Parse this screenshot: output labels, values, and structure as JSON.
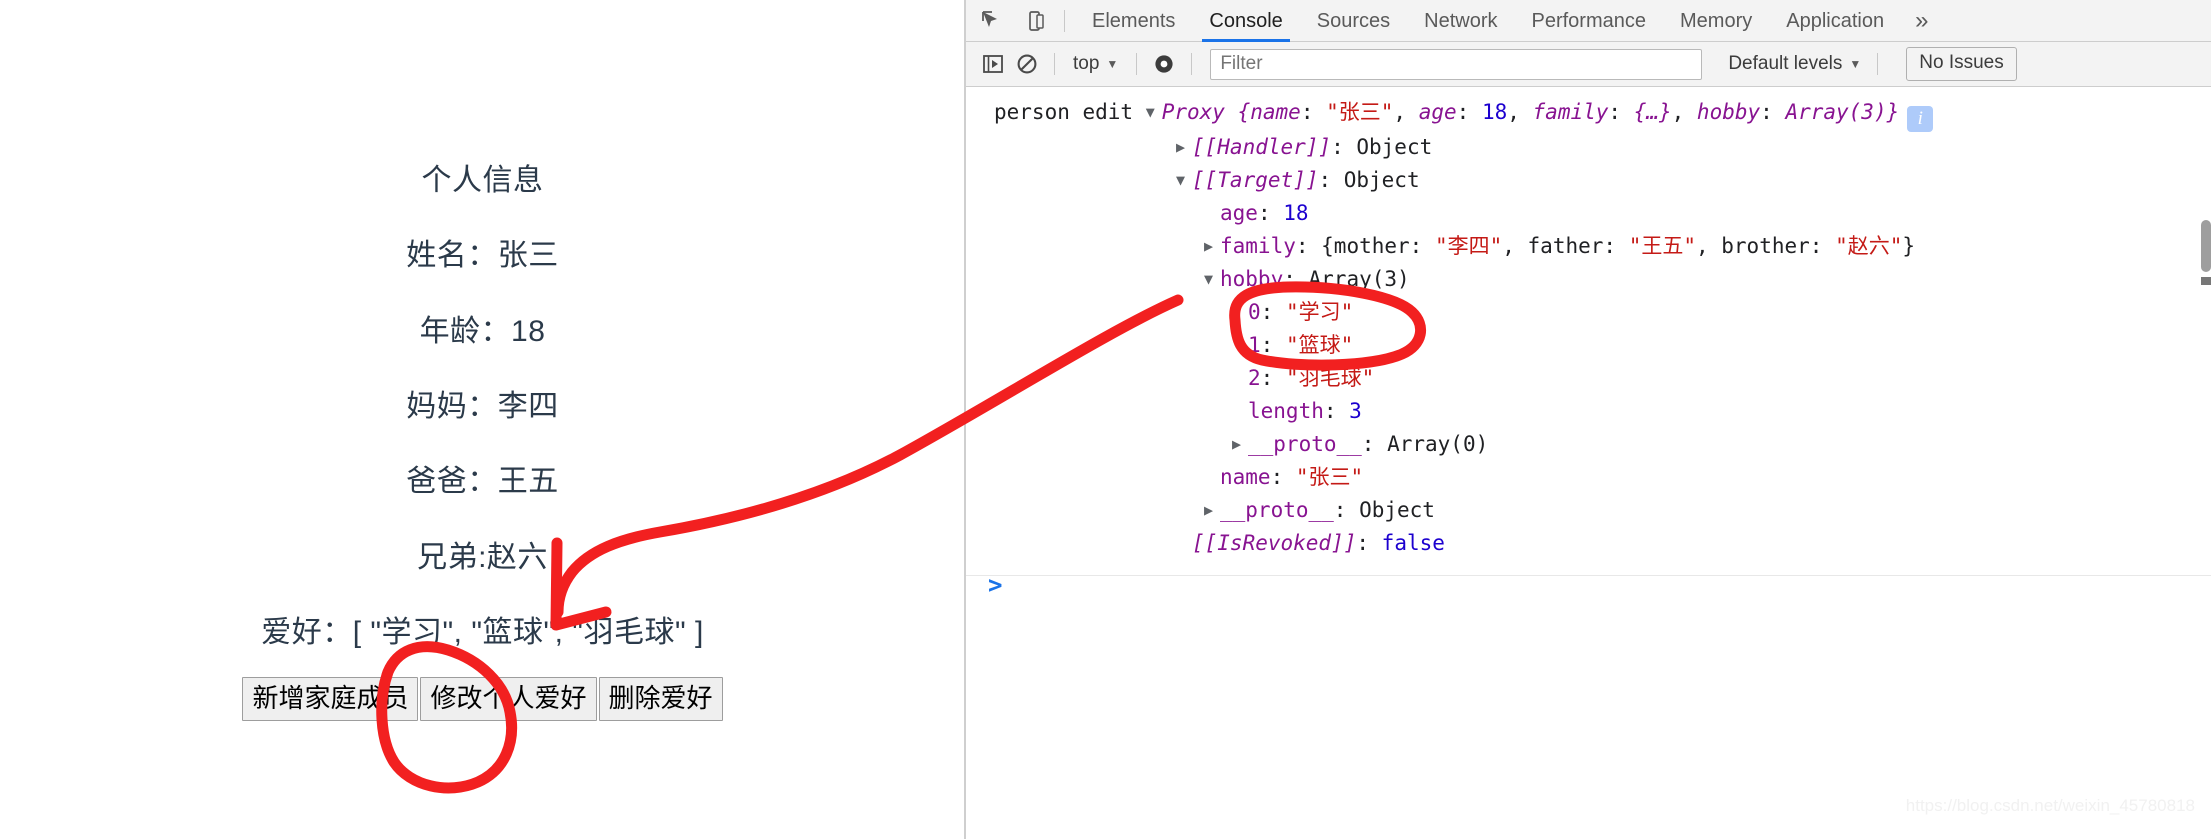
{
  "webpage": {
    "title": "个人信息",
    "rows": [
      "姓名：张三",
      "年龄：18",
      "妈妈：李四",
      "爸爸：王五",
      "兄弟:赵六",
      "爱好：[ \"学习\", \"篮球\", \"羽毛球\" ]"
    ],
    "buttons": [
      "新增家庭成员",
      "修改个人爱好",
      "删除爱好"
    ],
    "text_color": "#2b3a4a"
  },
  "devtools": {
    "icons": {
      "inspect": "inspect-element-icon",
      "device": "device-toolbar-icon",
      "execute": "execute-snippet-icon",
      "clear": "clear-console-icon",
      "eye": "live-expression-icon"
    },
    "tabs": [
      {
        "label": "Elements",
        "active": false
      },
      {
        "label": "Console",
        "active": true
      },
      {
        "label": "Sources",
        "active": false
      },
      {
        "label": "Network",
        "active": false
      },
      {
        "label": "Performance",
        "active": false
      },
      {
        "label": "Memory",
        "active": false
      },
      {
        "label": "Application",
        "active": false
      }
    ],
    "tab_overflow": "»",
    "console_toolbar": {
      "context": "top",
      "context_caret": "▼",
      "filter_placeholder": "Filter",
      "filter_value": "",
      "levels_label": "Default levels",
      "levels_caret": "▼",
      "issues_label": "No Issues"
    },
    "accent_color": "#1a73e8",
    "prompt": ">",
    "console_log": {
      "source_label": "person edit",
      "header": {
        "triangle": "▼",
        "type": "Proxy",
        "preview_open": " {",
        "fields": [
          {
            "key": "name",
            "sep": ": ",
            "value": "\"张三\"",
            "style": "str"
          },
          {
            "key": "age",
            "sep": ": ",
            "value": "18",
            "style": "num"
          },
          {
            "key": "family",
            "sep": ": ",
            "value": "{…}",
            "style": "plain"
          },
          {
            "key": "hobby",
            "sep": ": ",
            "value": "Array(3)",
            "style": "plain"
          }
        ],
        "preview_close": "}",
        "info_badge": "i"
      },
      "lines": [
        {
          "indent": 1,
          "tri": "▶",
          "key": "[[Handler]]",
          "italic": true,
          "sep": ": ",
          "value": "Object",
          "style": "plain"
        },
        {
          "indent": 1,
          "tri": "▼",
          "key": "[[Target]]",
          "italic": true,
          "sep": ": ",
          "value": "Object",
          "style": "plain"
        },
        {
          "indent": 2,
          "tri": "",
          "key": "age",
          "italic": false,
          "sep": ": ",
          "value": "18",
          "style": "num"
        },
        {
          "indent": 2,
          "tri": "▶",
          "key": "family",
          "italic": false,
          "sep": ": ",
          "value": "{mother: \"李四\", father: \"王五\", brother: \"赵六\"}",
          "style": "objpreview"
        },
        {
          "indent": 2,
          "tri": "▼",
          "key": "hobby",
          "italic": false,
          "sep": ": ",
          "value": "Array(3)",
          "style": "plain"
        },
        {
          "indent": 3,
          "tri": "",
          "key": "0",
          "italic": false,
          "sep": ": ",
          "value": "\"学习\"",
          "style": "str"
        },
        {
          "indent": 3,
          "tri": "",
          "key": "1",
          "italic": false,
          "sep": ": ",
          "value": "\"篮球\"",
          "style": "str"
        },
        {
          "indent": 3,
          "tri": "",
          "key": "2",
          "italic": false,
          "sep": ": ",
          "value": "\"羽毛球\"",
          "style": "str"
        },
        {
          "indent": 3,
          "tri": "",
          "key": "length",
          "italic": false,
          "sep": ": ",
          "value": "3",
          "style": "num"
        },
        {
          "indent": 3,
          "tri": "▶",
          "key": "__proto__",
          "italic": false,
          "sep": ": ",
          "value": "Array(0)",
          "style": "plain"
        },
        {
          "indent": 2,
          "tri": "",
          "key": "name",
          "italic": false,
          "sep": ": ",
          "value": "\"张三\"",
          "style": "str"
        },
        {
          "indent": 2,
          "tri": "▶",
          "key": "__proto__",
          "italic": false,
          "sep": ": ",
          "value": "Object",
          "style": "plain"
        },
        {
          "indent": 1,
          "tri": "",
          "key": "[[IsRevoked]]",
          "italic": true,
          "sep": ": ",
          "value": "false",
          "style": "num"
        }
      ]
    }
  },
  "annotations": {
    "color": "#ff0000",
    "marks": [
      {
        "name": "arrow-hobby-to-console",
        "kind": "arrow"
      },
      {
        "name": "circle-hobby-array-items",
        "kind": "ellipse"
      },
      {
        "name": "circle-edit-hobby-button",
        "kind": "ellipse"
      }
    ]
  },
  "watermark": "https://blog.csdn.net/weixin_45780818"
}
